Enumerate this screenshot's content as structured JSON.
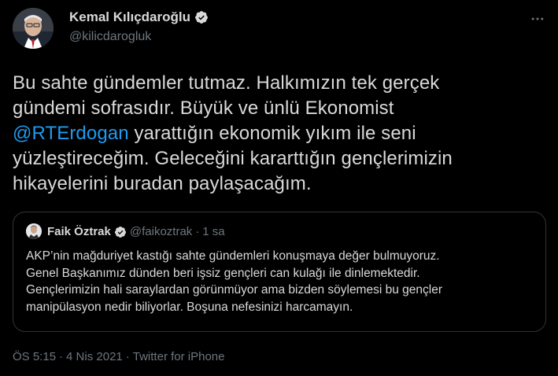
{
  "author": {
    "display_name": "Kemal Kılıçdaroğlu",
    "handle": "@kilicdarogluk"
  },
  "tweet": {
    "lines": [
      {
        "text": "Bu sahte gündemler tutmaz. Halkımızın tek gerçek"
      },
      {
        "text": "gündemi sofrasıdır. Büyük ve ünlü Ekonomist"
      },
      {
        "mention": "@RTErdogan",
        "text": " yarattığın ekonomik yıkım ile seni"
      },
      {
        "text": "yüzleştireceğim. Geleceğini kararttığın gençlerimizin"
      },
      {
        "text": "hikayelerini buradan paylaşacağım."
      }
    ]
  },
  "quoted_tweet": {
    "display_name": "Faik Öztrak",
    "handle": "@faikoztrak",
    "separator": "·",
    "time": "1 sa",
    "lines": [
      "AKP’nin mağduriyet kastığı sahte gündemleri konuşmaya değer bulmuyoruz.",
      "Genel Başkanımız dünden beri işsiz gençleri can kulağı ile dinlemektedir.",
      "Gençlerimizin hali saraylardan görünmüyor ama bizden söylemesi bu gençler",
      "manipülasyon nedir biliyorlar. Boşuna nefesinizi harcamayın."
    ]
  },
  "footer": {
    "time": "ÖS 5:15",
    "dot1": "·",
    "date": "4 Nis 2021",
    "dot2": "·",
    "source": "Twitter for iPhone"
  },
  "icons": {
    "verified": "verified-badge-icon",
    "more": "more-options-icon"
  },
  "colors": {
    "background": "#000000",
    "text": "#d9d9d9",
    "secondary": "#6e767d",
    "accent": "#1d9bf0",
    "border": "#2f3336"
  }
}
